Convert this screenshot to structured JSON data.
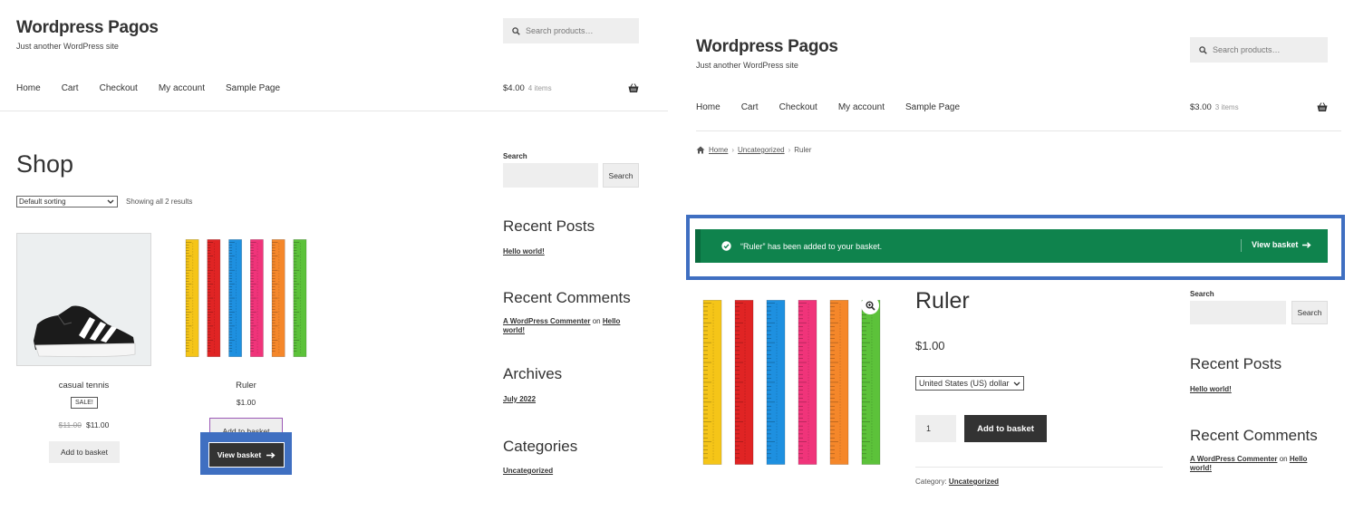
{
  "left": {
    "header": {
      "site_title": "Wordpress Pagos",
      "tagline": "Just another WordPress site",
      "search_placeholder": "Search products…",
      "nav": [
        "Home",
        "Cart",
        "Checkout",
        "My account",
        "Sample Page"
      ],
      "cart_total": "$4.00",
      "cart_items": "4 items"
    },
    "page_title": "Shop",
    "sorting": "Default sorting",
    "showing": "Showing all 2 results",
    "products": [
      {
        "name": "casual tennis",
        "badge": "SALE!",
        "old_price": "$11.00",
        "price": "$11.00",
        "button": "Add to basket"
      },
      {
        "name": "Ruler",
        "price": "$1.00",
        "button": "Add to basket",
        "view_basket": "View basket"
      }
    ],
    "sidebar": {
      "search_label": "Search",
      "search_button": "Search",
      "recent_posts_title": "Recent Posts",
      "recent_post": "Hello world!",
      "recent_comments_title": "Recent Comments",
      "comment_author": "A WordPress Commenter",
      "comment_on": "on",
      "comment_post": "Hello world!",
      "archives_title": "Archives",
      "archive_item": "July 2022",
      "categories_title": "Categories",
      "category_item": "Uncategorized"
    }
  },
  "right": {
    "header": {
      "site_title": "Wordpress Pagos",
      "tagline": "Just another WordPress site",
      "search_placeholder": "Search products…",
      "nav": [
        "Home",
        "Cart",
        "Checkout",
        "My account",
        "Sample Page"
      ],
      "cart_total": "$3.00",
      "cart_items": "3 items"
    },
    "breadcrumb": {
      "home": "Home",
      "category": "Uncategorized",
      "current": "Ruler"
    },
    "notice": {
      "message": "“Ruler” has been added to your basket.",
      "view_basket": "View basket"
    },
    "product": {
      "title": "Ruler",
      "price": "$1.00",
      "currency": "United States (US) dollar",
      "quantity": "1",
      "add_button": "Add to basket",
      "category_label": "Category:",
      "category": "Uncategorized"
    },
    "sidebar": {
      "search_label": "Search",
      "search_button": "Search",
      "recent_posts_title": "Recent Posts",
      "recent_post": "Hello world!",
      "recent_comments_title": "Recent Comments",
      "comment_author": "A WordPress Commenter",
      "comment_on": "on",
      "comment_post": "Hello world!"
    }
  },
  "colors": {
    "notice_green": "#0f834d",
    "highlight_blue": "#3f6fc1",
    "dark_button": "#333333",
    "ruler_colors": [
      "#f5c518",
      "#e02424",
      "#1e90e0",
      "#f0347a",
      "#f5872a",
      "#5cc23a"
    ]
  }
}
